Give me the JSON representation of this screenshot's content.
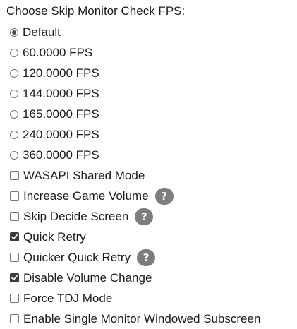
{
  "heading": "Choose Skip Monitor Check FPS:",
  "fps_options": [
    {
      "label": "Default",
      "selected": true
    },
    {
      "label": "60.0000 FPS",
      "selected": false
    },
    {
      "label": "120.0000 FPS",
      "selected": false
    },
    {
      "label": "144.0000 FPS",
      "selected": false
    },
    {
      "label": "165.0000 FPS",
      "selected": false
    },
    {
      "label": "240.0000 FPS",
      "selected": false
    },
    {
      "label": "360.0000 FPS",
      "selected": false
    }
  ],
  "checkboxes": [
    {
      "label": "WASAPI Shared Mode",
      "checked": false,
      "help": false
    },
    {
      "label": "Increase Game Volume",
      "checked": false,
      "help": true
    },
    {
      "label": "Skip Decide Screen",
      "checked": false,
      "help": true
    },
    {
      "label": "Quick Retry",
      "checked": true,
      "help": false
    },
    {
      "label": "Quicker Quick Retry",
      "checked": false,
      "help": true
    },
    {
      "label": "Disable Volume Change",
      "checked": true,
      "help": false
    },
    {
      "label": "Force TDJ Mode",
      "checked": false,
      "help": false
    },
    {
      "label": "Enable Single Monitor Windowed Subscreen",
      "checked": false,
      "help": false
    }
  ],
  "help_glyph": "?"
}
